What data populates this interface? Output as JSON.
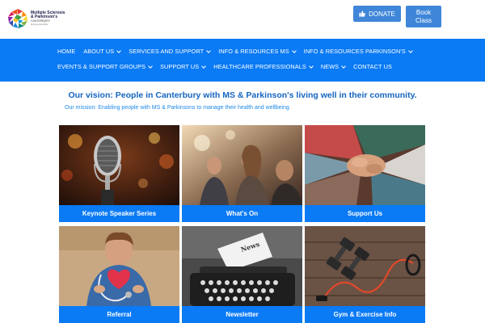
{
  "logo": {
    "line1": "Multiple Sclerosis",
    "line2": "& Parkinson's",
    "line3": "CANTERBURY",
    "line4": "living powerfully"
  },
  "header": {
    "donate_label": "DONATE",
    "book_label_1": "Book",
    "book_label_2": "Class"
  },
  "nav": {
    "row1": [
      {
        "label": "HOME",
        "dropdown": false
      },
      {
        "label": "ABOUT US",
        "dropdown": true
      },
      {
        "label": "SERVICES AND SUPPORT",
        "dropdown": true
      },
      {
        "label": "INFO & RESOURCES MS",
        "dropdown": true
      },
      {
        "label": "INFO & RESOURCES PARKINSON'S",
        "dropdown": true
      }
    ],
    "row2": [
      {
        "label": "EVENTS & SUPPORT GROUPS",
        "dropdown": true
      },
      {
        "label": "SUPPORT US",
        "dropdown": true
      },
      {
        "label": "HEALTHCARE PROFESSIONALS",
        "dropdown": true
      },
      {
        "label": "NEWS",
        "dropdown": true
      },
      {
        "label": "CONTACT US",
        "dropdown": false
      }
    ]
  },
  "intro": {
    "vision": "Our vision: People in Canterbury with MS & Parkinson's living well in their community.",
    "mission": "Our mission: Enabling people with MS & Parkinsons to manage their health and wellbeing."
  },
  "tiles": [
    {
      "label": "Keynote Speaker Series",
      "image": "microphone"
    },
    {
      "label": "What's On",
      "image": "people-gathering"
    },
    {
      "label": "Support Us",
      "image": "hands-together"
    },
    {
      "label": "Referral",
      "image": "heart-stethoscope"
    },
    {
      "label": "Newsletter",
      "image": "typewriter-news"
    },
    {
      "label": "Gym & Exercise Info",
      "image": "dumbbells-band"
    }
  ],
  "colors": {
    "nav_bg": "#0a7af5",
    "button_bg": "#3f86d9",
    "vision_text": "#1565c0",
    "mission_text": "#1e88e5"
  }
}
